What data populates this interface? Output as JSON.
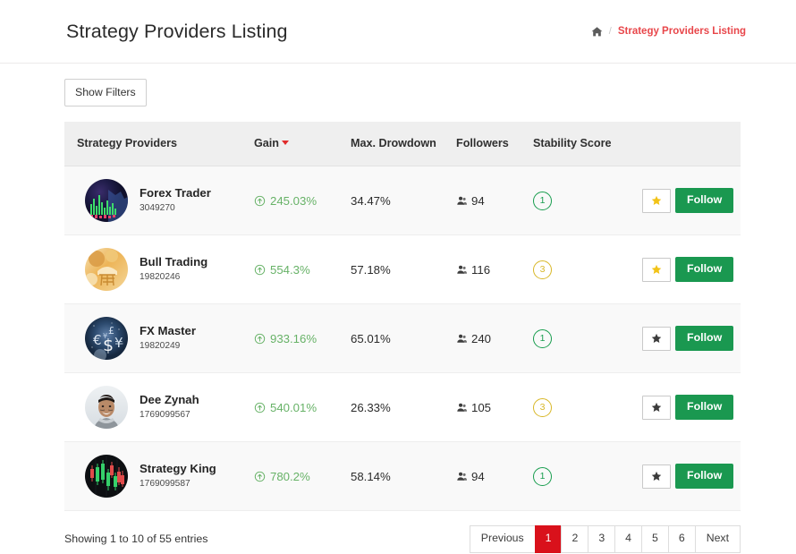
{
  "header": {
    "title": "Strategy Providers Listing",
    "breadcrumb": {
      "home_icon": "home-icon",
      "separator": "/",
      "current": "Strategy Providers Listing"
    }
  },
  "toolbar": {
    "filters_label": "Show Filters"
  },
  "table": {
    "columns": [
      {
        "label": "Strategy Providers",
        "sortable": false
      },
      {
        "label": "Gain",
        "sortable": true,
        "sort_dir": "desc",
        "sort_color": "#e02b2b"
      },
      {
        "label": "Max. Drowdown",
        "sortable": false
      },
      {
        "label": "Followers",
        "sortable": false
      },
      {
        "label": "Stability Score",
        "sortable": false
      },
      {
        "label": "",
        "sortable": false
      }
    ],
    "rows": [
      {
        "name": "Forex Trader",
        "id": "3049270",
        "gain": "245.03%",
        "drawdown": "34.47%",
        "followers": "94",
        "stability": "1",
        "stability_color": "#189d4e",
        "starred": true,
        "follow_label": "Follow",
        "avatar": "chart-dark-blue"
      },
      {
        "name": "Bull Trading",
        "id": "19820246",
        "gain": "554.3%",
        "drawdown": "57.18%",
        "followers": "116",
        "stability": "3",
        "stability_color": "#d8b727",
        "starred": true,
        "follow_label": "Follow",
        "avatar": "golden-coins"
      },
      {
        "name": "FX Master",
        "id": "19820249",
        "gain": "933.16%",
        "drawdown": "65.01%",
        "followers": "240",
        "stability": "1",
        "stability_color": "#189d4e",
        "starred": false,
        "follow_label": "Follow",
        "avatar": "currency-blue"
      },
      {
        "name": "Dee Zynah",
        "id": "1769099567",
        "gain": "540.01%",
        "drawdown": "26.33%",
        "followers": "105",
        "stability": "3",
        "stability_color": "#d8b727",
        "starred": false,
        "follow_label": "Follow",
        "avatar": "person-photo"
      },
      {
        "name": "Strategy King",
        "id": "1769099587",
        "gain": "780.2%",
        "drawdown": "58.14%",
        "followers": "94",
        "stability": "1",
        "stability_color": "#189d4e",
        "starred": false,
        "follow_label": "Follow",
        "avatar": "candlestick-dark"
      }
    ]
  },
  "footer": {
    "entries_info": "Showing 1 to 10 of 55 entries",
    "pagination": {
      "previous_label": "Previous",
      "next_label": "Next",
      "pages": [
        "1",
        "2",
        "3",
        "4",
        "5",
        "6"
      ],
      "active_page": "1",
      "active_color": "#d9111b"
    }
  },
  "theme": {
    "accent_red": "#e8464a",
    "gain_green": "#67b267",
    "follow_green": "#1a9850",
    "star_on": "#f2c318",
    "star_off": "#3b3b3b"
  }
}
